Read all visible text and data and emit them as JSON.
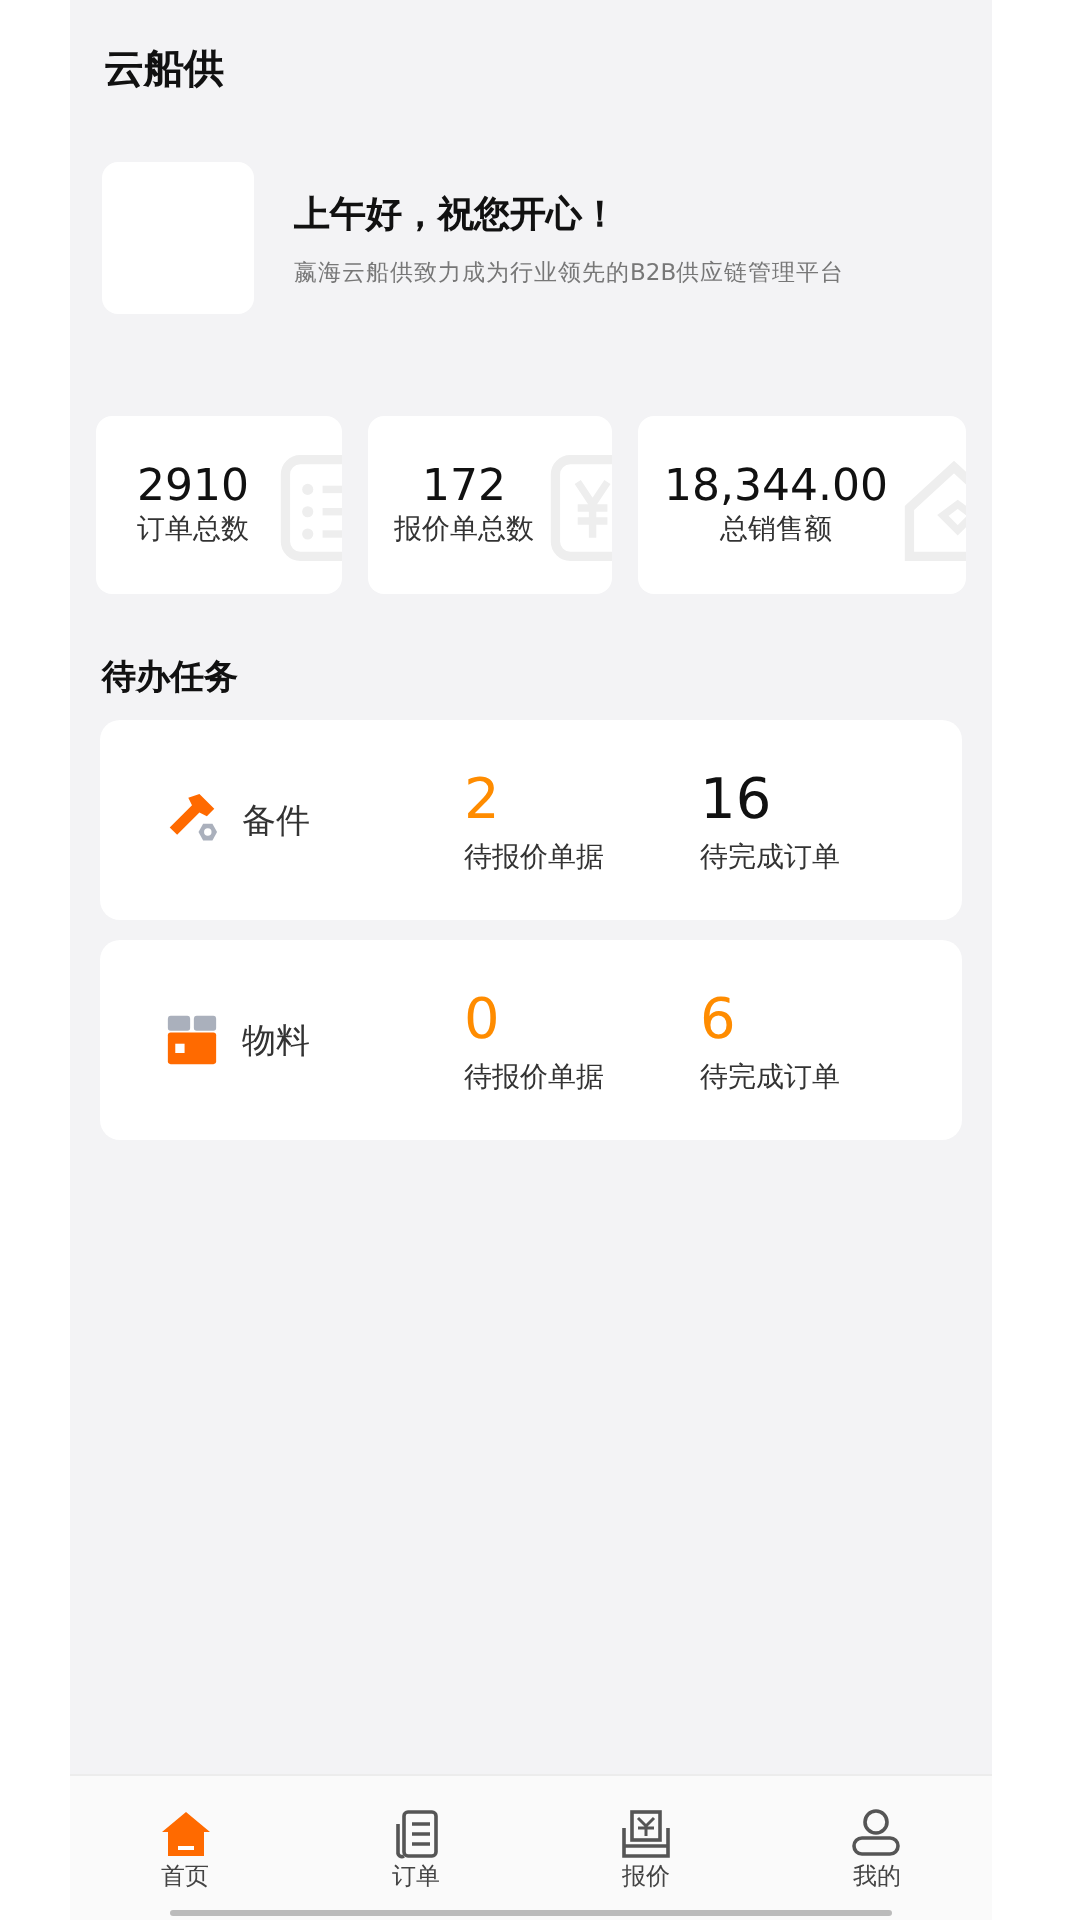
{
  "header": {
    "title": "云船供"
  },
  "welcome": {
    "greeting": "上午好，祝您开心！",
    "subtitle": "嬴海云船供致力成为行业领先的B2B供应链管理平台"
  },
  "stats": [
    {
      "value": "2910",
      "label": "订单总数",
      "kind": "list"
    },
    {
      "value": "172",
      "label": "报价单总数",
      "kind": "yen"
    },
    {
      "value": "18,344.00",
      "label": "总销售额",
      "kind": "house"
    }
  ],
  "todo": {
    "title": "待办任务",
    "tasks": [
      {
        "name": "备件",
        "kind": "parts",
        "metrics": [
          {
            "value": "2",
            "label": "待报价单据",
            "highlight": true
          },
          {
            "value": "16",
            "label": "待完成订单",
            "highlight": false
          }
        ]
      },
      {
        "name": "物料",
        "kind": "materials",
        "metrics": [
          {
            "value": "0",
            "label": "待报价单据",
            "highlight": true
          },
          {
            "value": "6",
            "label": "待完成订单",
            "highlight": true
          }
        ]
      }
    ]
  },
  "tab_bar": [
    {
      "label": "首页",
      "kind": "home",
      "selected": true
    },
    {
      "label": "订单",
      "kind": "orders",
      "selected": false
    },
    {
      "label": "报价",
      "kind": "quote",
      "selected": false
    },
    {
      "label": "我的",
      "kind": "profile",
      "selected": false
    }
  ]
}
